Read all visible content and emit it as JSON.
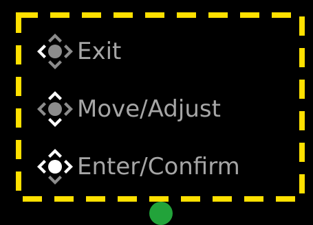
{
  "colors": {
    "background": "#000000",
    "dashed_border": "#ffe000",
    "icon_active": "#ffffff",
    "icon_inactive": "#8c8c8c",
    "label_text": "#a6a6a6",
    "indicator": "#22a33a"
  },
  "legend": {
    "items": [
      {
        "label": "Exit",
        "icon": "joystick-left-press-icon",
        "active_parts": [
          "left"
        ]
      },
      {
        "label": "Move/Adjust",
        "icon": "joystick-up-down-icon",
        "active_parts": [
          "up",
          "down"
        ]
      },
      {
        "label": "Enter/Confirm",
        "icon": "joystick-center-press-icon",
        "active_parts": [
          "center"
        ]
      }
    ]
  }
}
